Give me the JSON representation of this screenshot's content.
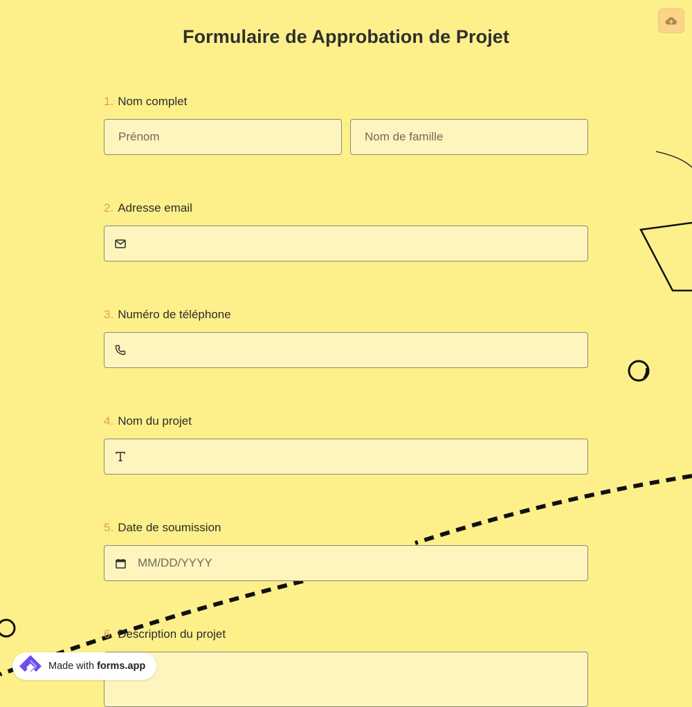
{
  "form": {
    "title": "Formulaire de Approbation de Projet",
    "questions": [
      {
        "num": "1.",
        "label": "Nom complet",
        "first_placeholder": "Prénom",
        "last_placeholder": "Nom de famille"
      },
      {
        "num": "2.",
        "label": "Adresse email",
        "icon": "mail-icon"
      },
      {
        "num": "3.",
        "label": "Numéro de téléphone",
        "icon": "phone-icon"
      },
      {
        "num": "4.",
        "label": "Nom du projet",
        "icon": "text-icon"
      },
      {
        "num": "5.",
        "label": "Date de soumission",
        "icon": "calendar-icon",
        "placeholder": "MM/DD/YYYY"
      },
      {
        "num": "6.",
        "label": "Description du projet"
      }
    ]
  },
  "toolbar": {
    "save_icon": "cloud-upload-icon"
  },
  "badge": {
    "prefix": "Made with",
    "brand": "forms.app"
  },
  "colors": {
    "background": "#fdf08a",
    "field": "#fdf5bd",
    "number": "#e59a5a",
    "save_button": "#fbd48a"
  }
}
